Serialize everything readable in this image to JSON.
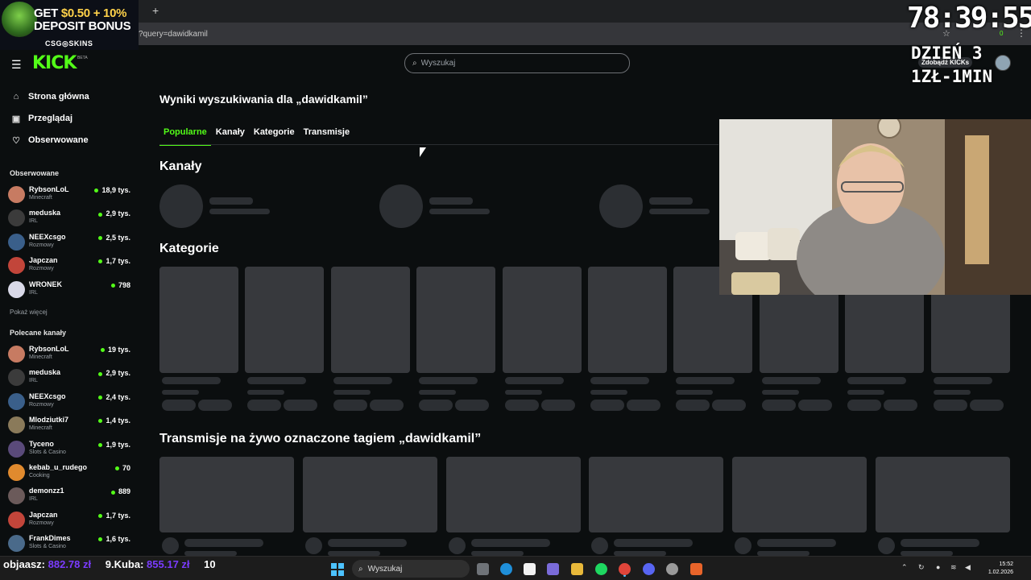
{
  "browser": {
    "url_fragment": "?query=dawidkamil",
    "new_tab_symbol": "+",
    "toolbar_badge": "0"
  },
  "promo": {
    "line1_a": "GET ",
    "line1_b": "$0.50 + 10%",
    "line2": "DEPOSIT BONUS",
    "brand": "CSG◎SKINS"
  },
  "overlay": {
    "timer": "78:39:55",
    "day": "DZIEŃ 3",
    "rate": "1ZŁ-1MIN",
    "kicks_button": "Zdobądź KICKs"
  },
  "logo": {
    "text": "KICK",
    "beta": "BETA"
  },
  "nav": [
    {
      "label": "Strona główna",
      "icon": "home-icon",
      "glyph": "⌂"
    },
    {
      "label": "Przeglądaj",
      "icon": "browse-icon",
      "glyph": "▣"
    },
    {
      "label": "Obserwowane",
      "icon": "heart-icon",
      "glyph": "♡"
    }
  ],
  "followed": {
    "title": "Obserwowane",
    "more": "Pokaż więcej",
    "channels": [
      {
        "name": "RybsonLoL",
        "category": "Minecraft",
        "viewers": "18,9 tys.",
        "color": "#c77b62"
      },
      {
        "name": "meduska",
        "category": "IRL",
        "viewers": "2,9 tys.",
        "color": "#3b3b3b"
      },
      {
        "name": "NEEXcsgo",
        "category": "Rozmowy",
        "viewers": "2,5 tys.",
        "color": "#3a5f8a"
      },
      {
        "name": "Japczan",
        "category": "Rozmowy",
        "viewers": "1,7 tys.",
        "color": "#c2453a"
      },
      {
        "name": "WRONEK",
        "category": "IRL",
        "viewers": "798",
        "color": "#d9d9e8"
      }
    ]
  },
  "recommended": {
    "title": "Polecane kanały",
    "channels": [
      {
        "name": "RybsonLoL",
        "category": "Minecraft",
        "viewers": "19 tys.",
        "color": "#c77b62"
      },
      {
        "name": "meduska",
        "category": "IRL",
        "viewers": "2,9 tys.",
        "color": "#3b3b3b"
      },
      {
        "name": "NEEXcsgo",
        "category": "Rozmowy",
        "viewers": "2,4 tys.",
        "color": "#3a5f8a"
      },
      {
        "name": "Mlodziutki7",
        "category": "Minecraft",
        "viewers": "1,4 tys.",
        "color": "#8a7a5a"
      },
      {
        "name": "Tyceno",
        "category": "Slots & Casino",
        "viewers": "1,9 tys.",
        "color": "#5a4a7a"
      },
      {
        "name": "kebab_u_rudego",
        "category": "Cooking",
        "viewers": "70",
        "color": "#e08a2e"
      },
      {
        "name": "demonzz1",
        "category": "IRL",
        "viewers": "889",
        "color": "#6b5a5a"
      },
      {
        "name": "Japczan",
        "category": "Rozmowy",
        "viewers": "1,7 tys.",
        "color": "#c2453a"
      },
      {
        "name": "FrankDimes",
        "category": "Slots & Casino",
        "viewers": "1,6 tys.",
        "color": "#4a6a8a"
      }
    ]
  },
  "search": {
    "placeholder": "Wyszukaj"
  },
  "results": {
    "title": "Wyniki wyszukiwania dla „dawidkamil”"
  },
  "tabs": [
    {
      "label": "Popularne",
      "active": true
    },
    {
      "label": "Kanały"
    },
    {
      "label": "Kategorie"
    },
    {
      "label": "Transmisje"
    }
  ],
  "sections": {
    "channels": "Kanały",
    "categories": "Kategorie",
    "streams": "Transmisje na żywo oznaczone tagiem „dawidkamil”"
  },
  "taskbar": {
    "ticker_a": "objaasz: ",
    "ticker_a_amount": "882.78 zł",
    "ticker_b": "9.Kuba: ",
    "ticker_b_amount": "855.17 zł",
    "ticker_c": "10",
    "search": "Wyszukaj",
    "time": "15:52",
    "date": "1.02.2026"
  },
  "colors": {
    "accent": "#53fc18",
    "bg": "#0b0e0f",
    "skeleton": "#37393d"
  }
}
